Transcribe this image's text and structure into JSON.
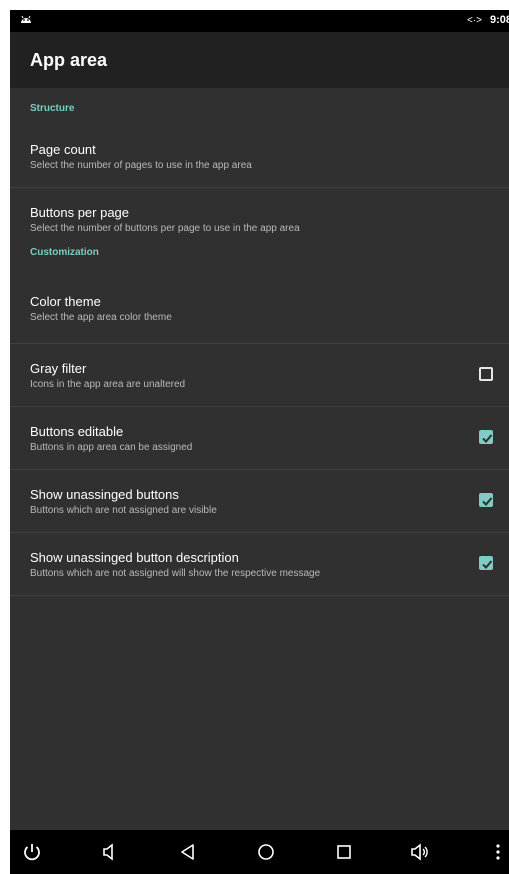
{
  "status_bar": {
    "time": "9:08",
    "connection_indicator": "<·>",
    "notification_icon": "android-icon"
  },
  "app_bar": {
    "title": "App area"
  },
  "categories": {
    "structure": "Structure",
    "customization": "Customization"
  },
  "preferences": {
    "page_count": {
      "title": "Page count",
      "summary": "Select the number of pages to use in the app area"
    },
    "buttons_per_page": {
      "title": "Buttons per page",
      "summary": "Select the number of buttons per page to use in the app area"
    },
    "color_theme": {
      "title": "Color theme",
      "summary": "Select the app area color theme"
    },
    "gray_filter": {
      "title": "Gray filter",
      "summary": "Icons in the app area are unaltered",
      "checked": false
    },
    "buttons_editable": {
      "title": "Buttons editable",
      "summary": "Buttons in app area can be assigned",
      "checked": true
    },
    "show_unassigned_buttons": {
      "title": "Show unassinged buttons",
      "summary": "Buttons which are not assigned are visible",
      "checked": true
    },
    "show_unassigned_button_description": {
      "title": "Show unassinged button description",
      "summary": "Buttons which are not assigned will show the respective message",
      "checked": true
    }
  },
  "nav_bar": {
    "icons": [
      "power-icon",
      "volume-down-icon",
      "back-icon",
      "home-icon",
      "recents-icon",
      "volume-up-icon",
      "more-icon"
    ]
  },
  "colors": {
    "accent": "#80cbc4",
    "background": "#303030",
    "app_bar": "#212121"
  }
}
